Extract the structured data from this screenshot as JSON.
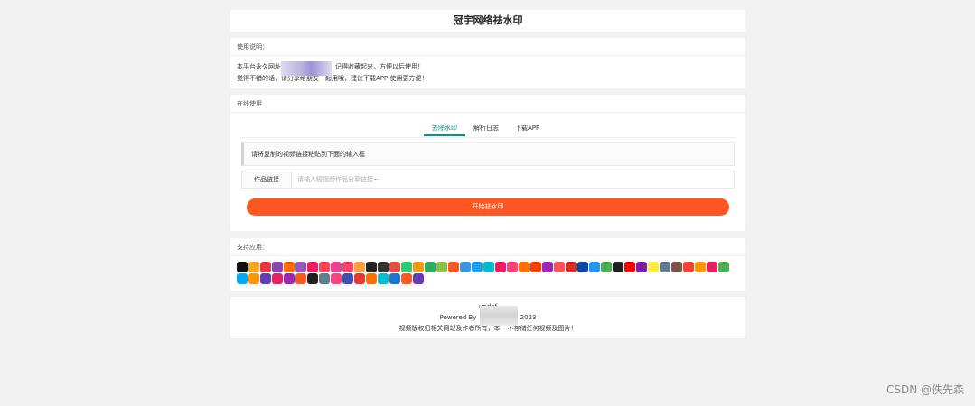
{
  "header": {
    "title": "冠宇网络祛水印"
  },
  "usage": {
    "title": "使用说明：",
    "line1": "本平台永久网址",
    "line1_tail": "记得收藏起来，方便以后使用！",
    "line2": "觉得不错的话，请分享给朋友一起用哦，建议下载APP 使用更方便！"
  },
  "online": {
    "title": "在线使用",
    "tabs": [
      {
        "label": "去除水印"
      },
      {
        "label": "解析日志"
      },
      {
        "label": "下载APP"
      }
    ],
    "tip": "请将复制的视频链接粘贴到下面的输入框",
    "input_label": "作品链接",
    "input_placeholder": "请输入短视频作品分享链接~",
    "submit": "开始祛水印"
  },
  "apps": {
    "title": "支持应用：",
    "icons": [
      "tiktok-icon",
      "#f5a623",
      "#e63946",
      "#8e44ad",
      "#ff6b00",
      "#9b59b6",
      "#e91e63",
      "#ff4757",
      "#e84393",
      "#ff3f6c",
      "#ff9f43",
      "#222222",
      "#333333",
      "#e74c3c",
      "#2ecc71",
      "#f39c12",
      "#27ae60",
      "#8bc34a",
      "#ff5722",
      "#3498db",
      "#1da1f2",
      "#00bcd4",
      "#e91e63",
      "#ff4081",
      "#ff6f00",
      "#ff3d00",
      "#9c27b0",
      "#ff5252",
      "#d32f2f",
      "#0d47a1",
      "#2196f3",
      "#4caf50",
      "#212121",
      "#ff0000",
      "#7b1fa2",
      "#ffeb3b",
      "#607d8b",
      "#795548",
      "#f44336",
      "#ff9800",
      "#e91e63",
      "#4caf50",
      "#03a9f4",
      "#ff9800",
      "#673ab7",
      "#e91e63",
      "#9c27b0",
      "#ff5722",
      "#212121",
      "#607d8b",
      "#ff4081",
      "#3f51b5",
      "#e53935",
      "#ff6f00",
      "#00bcd4",
      "#1976d2",
      "#ff5722",
      "#673ab7"
    ]
  },
  "footer": {
    "line1": "undef",
    "line2_start": "Powered By ",
    "line2_end": "2023",
    "line3_start": "视频版权归相关网站及作者所有，本",
    "line3_end": "不存储任何视频及图片！"
  },
  "watermark": "CSDN @佚先森"
}
